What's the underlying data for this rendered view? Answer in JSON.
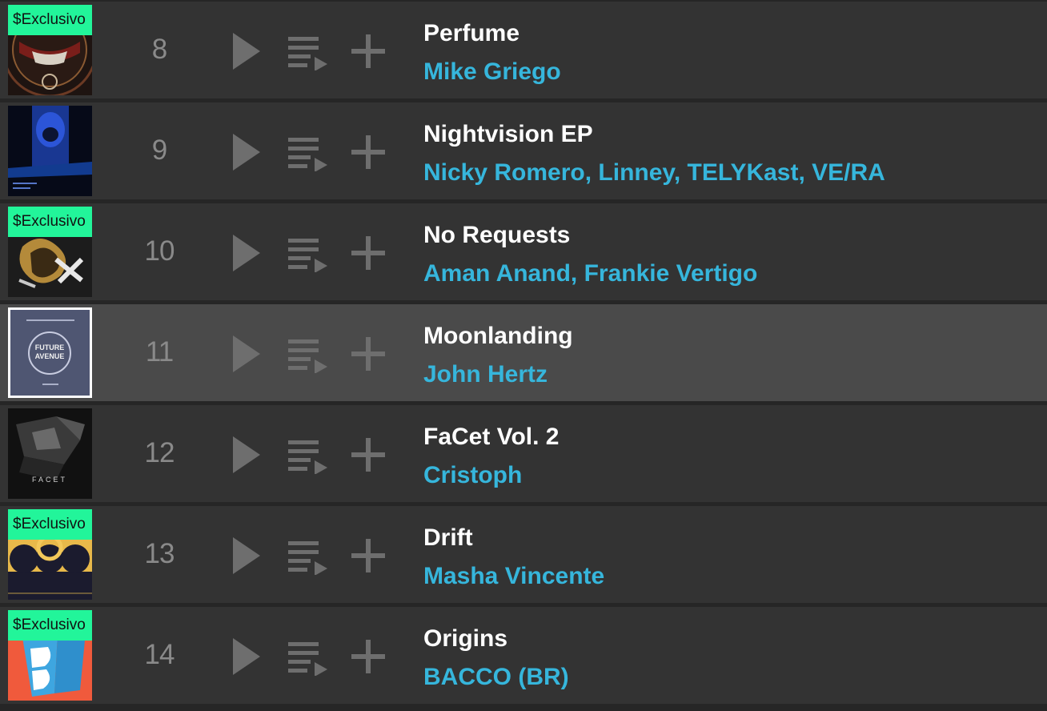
{
  "tracks": [
    {
      "rank": "8",
      "badge": "$Exclusivo",
      "title": "Perfume",
      "artists": "Mike Griego"
    },
    {
      "rank": "9",
      "badge": "",
      "title": "Nightvision EP",
      "artists": "Nicky Romero, Linney, TELYKast, VE/RA"
    },
    {
      "rank": "10",
      "badge": "$Exclusivo",
      "title": "No Requests",
      "artists": "Aman Anand, Frankie Vertigo"
    },
    {
      "rank": "11",
      "badge": "",
      "title": "Moonlanding",
      "artists": "John Hertz",
      "cover_text": [
        "FUTURE",
        "AVENUE"
      ]
    },
    {
      "rank": "12",
      "badge": "",
      "title": "FaCet Vol. 2",
      "artists": "Cristoph",
      "cover_text": [
        "FACET"
      ]
    },
    {
      "rank": "13",
      "badge": "$Exclusivo",
      "title": "Drift",
      "artists": "Masha Vincente"
    },
    {
      "rank": "14",
      "badge": "$Exclusivo",
      "title": "Origins",
      "artists": "BACCO (BR)"
    }
  ],
  "highlighted_rank": "11",
  "icons": {
    "play": "play-icon",
    "queue": "add-to-queue-icon",
    "add": "plus-icon"
  },
  "colors": {
    "artist_link": "#36b6dc",
    "badge": "#22f59a",
    "row_bg": "#333333",
    "row_highlight": "#4a4a4a"
  }
}
